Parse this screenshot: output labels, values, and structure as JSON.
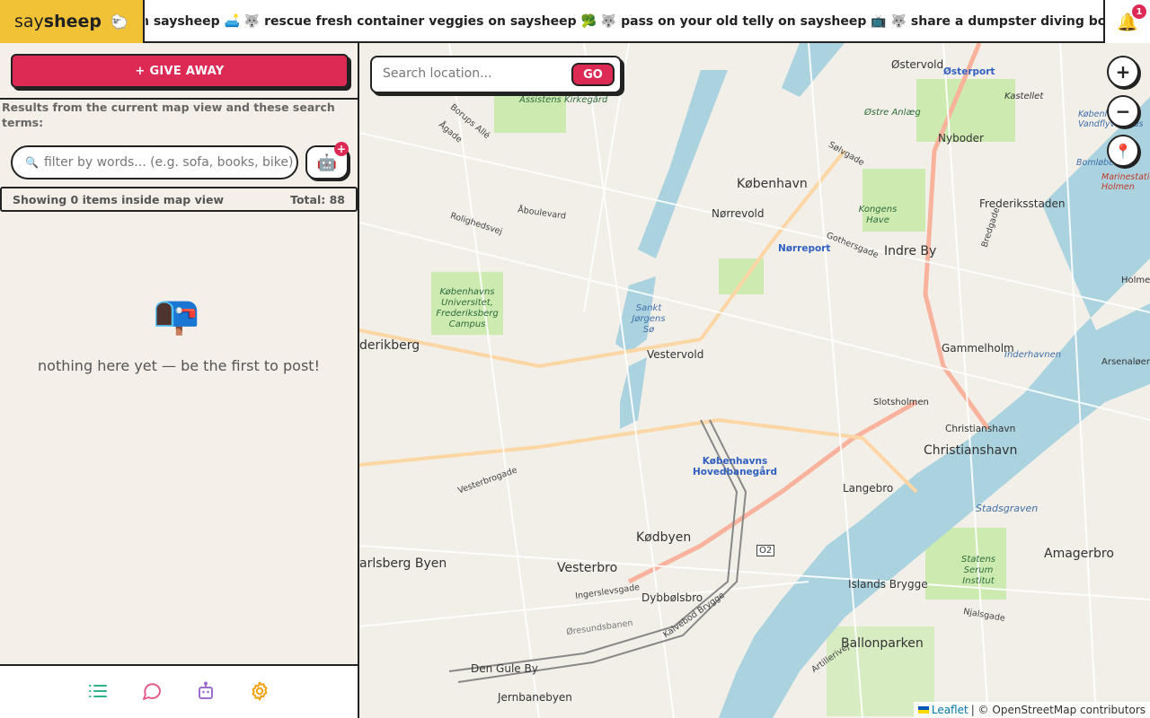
{
  "app": {
    "brand_prefix": "say",
    "brand_bold": "sheep",
    "brand_icon": "sheep-icon",
    "ticker": "n saysheep 🛋️ 🐺 rescue fresh container veggies on saysheep 🥦 🐺 pass on your old telly on saysheep 📺 🐺 share a dumpster diving bounty on saysheep",
    "notifications_count": "1"
  },
  "sidebar": {
    "give_away_label": "+ GIVE AWAY",
    "results_note": "Results from the current map view and these search terms:",
    "filter_placeholder": "filter by words... (e.g. sofa, books, bike)",
    "robot_badge": "+",
    "showing_text": "Showing 0 items inside map view",
    "total_text": "Total: 88",
    "empty_icon": "📭",
    "empty_text": "nothing here yet — be the first to post!"
  },
  "bottom_nav": {
    "items": [
      {
        "icon": "list-icon",
        "color": "#2fb38a"
      },
      {
        "icon": "chat-icon",
        "color": "#e05c8a"
      },
      {
        "icon": "robot-icon",
        "color": "#9b6fd0"
      },
      {
        "icon": "gear-icon",
        "color": "#f2a20e"
      }
    ]
  },
  "map": {
    "search_placeholder": "Search location...",
    "go_label": "GO",
    "zoom_in": "+",
    "zoom_out": "−",
    "attribution_leaflet": "Leaflet",
    "attribution_rest": "| © OpenStreetMap contributors",
    "labels": {
      "kobenhavn": "København",
      "norrevold": "Nørrevold",
      "norreport": "Nørreport",
      "indre_by": "Indre By",
      "frederiksstaden": "Frederiksstaden",
      "nyboder": "Nyboder",
      "ostervold": "Østervold",
      "osterport": "Østerport",
      "kastellet": "Kastellet",
      "gammelholm": "Gammelholm",
      "vestervold": "Vestervold",
      "frederiksberg": "derikberg",
      "hovedbanegard": "Københavns Hovedbanegård",
      "slotsholmen": "Slotsholmen",
      "christianshavn_small": "Christianshavn",
      "christianshavn": "Christianshavn",
      "langebro": "Langebro",
      "kodbyen": "Kødbyen",
      "vesterbro": "Vesterbro",
      "dybbolsbro": "Dybbølsbro",
      "islands_brygge": "Islands Brygge",
      "amagerbro": "Amagerbro",
      "ballonparken": "Ballonparken",
      "carlsberg_byen": "arlsberg Byen",
      "den_gule_by": "Den Gule By",
      "jernbanebyen": "Jernbanebyen",
      "arsenaloen": "Arsenaløen",
      "holmen": "Holme",
      "kastellet_area": "Kastellet",
      "assistens": "Assistens Kirkegård",
      "kobenhavns_universitet": "Københavns Universitet, Frederiksberg Campus",
      "kongens_have": "Kongens Have",
      "sankt_jorgens_so": "Sankt Jørgens Sø",
      "statens_serum": "Statens Serum Institut",
      "stadsgraven": "Stadsgraven",
      "o2": "O2",
      "osterbrogade": "Østre Anlæg",
      "gothersgade": "Gothersgade",
      "solvgade": "Sølvgade",
      "aboulevard": "Åboulevard",
      "rolighedsvej": "Rolighedsvej",
      "ingerslevsgade": "Ingerslevsgade",
      "kalvebod_brygge": "Kalvebod Brygge",
      "vesterbrogade": "Vesterbrogade",
      "njalsgade": "Njalsgade",
      "borups_alle": "Borups Allé",
      "agade": "Ågade",
      "bredgade": "Bredgade",
      "artillerivej": "Artillerivej",
      "oresundsbanen": "Øresundsbanen",
      "inderhavnen": "Inderhavnen",
      "marinestation": "Marinestation Holmen",
      "bomlobet": "Bomløbet",
      "kobenhavns_vandflyveplads": "Københavns Vandflyveplads"
    }
  }
}
